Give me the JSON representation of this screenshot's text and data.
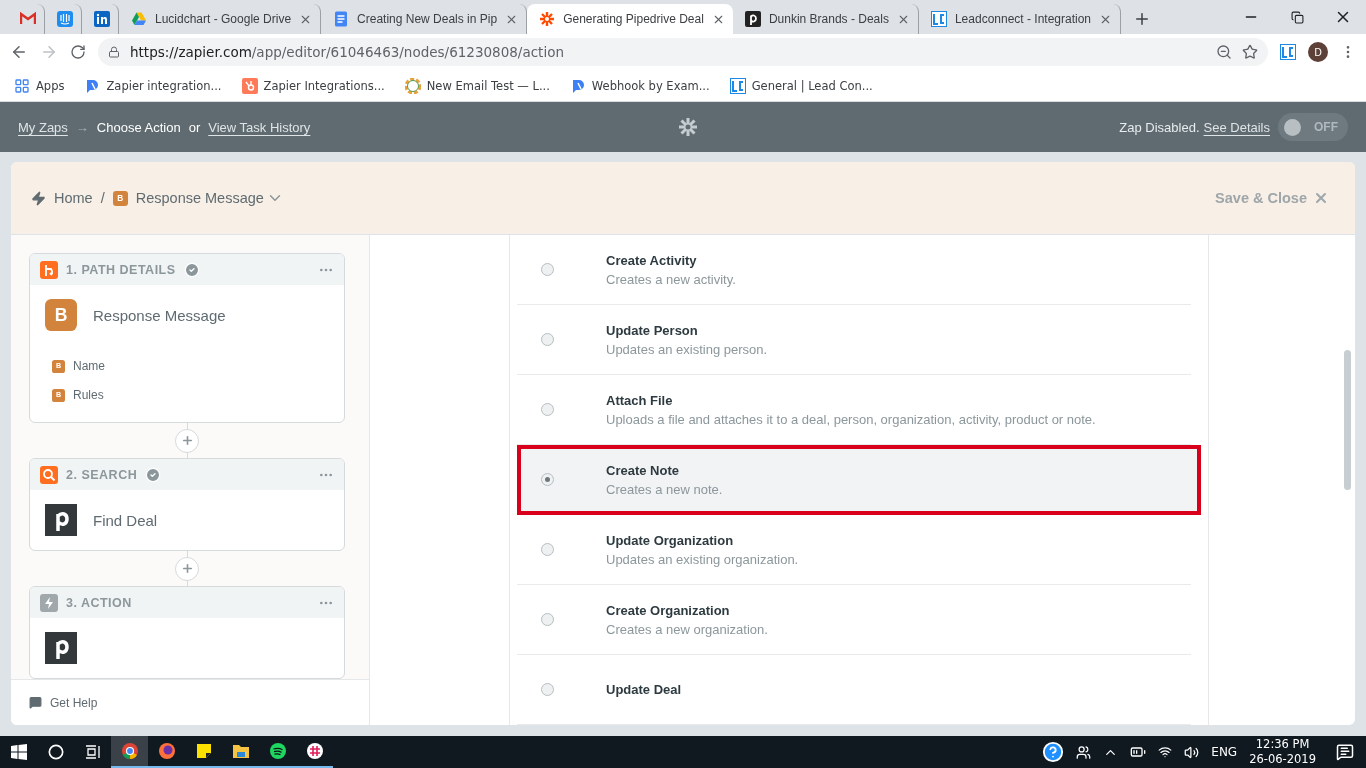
{
  "browser": {
    "tabs": [
      {
        "kind": "gmail",
        "selected": false
      },
      {
        "kind": "intercom",
        "selected": false
      },
      {
        "kind": "linkedin",
        "selected": false
      },
      {
        "kind": "drive",
        "title": "Lucidchart - Google Drive",
        "selected": false
      },
      {
        "kind": "docs",
        "title": "Creating New Deals in Pip",
        "selected": false
      },
      {
        "kind": "zapier",
        "title": "Generating Pipedrive Deal",
        "selected": true
      },
      {
        "kind": "pipedrive",
        "title": "Dunkin Brands - Deals",
        "selected": false
      },
      {
        "kind": "leadconnect",
        "title": "Leadconnect - Integration",
        "selected": false
      }
    ],
    "url_host": "https://zapier.com",
    "url_path": "/app/editor/61046463/nodes/61230808/action",
    "profile_initial": "D",
    "bookmarks": [
      {
        "kind": "apps",
        "label": "Apps"
      },
      {
        "kind": "webhook",
        "label": "Zapier integration..."
      },
      {
        "kind": "hubspot",
        "label": "Zapier Integrations..."
      },
      {
        "kind": "wheel",
        "label": "New Email Test — L..."
      },
      {
        "kind": "webhook",
        "label": "Webhook by Exam..."
      },
      {
        "kind": "leadconnect",
        "label": "General | Lead Con..."
      }
    ]
  },
  "topbar": {
    "my_zaps": "My Zaps",
    "arrow": "→",
    "current": "Choose Action",
    "or": "or",
    "history": "View Task History",
    "status": "Zap Disabled.",
    "details": "See Details",
    "toggle": {
      "on": false,
      "label": "OFF"
    }
  },
  "breadcrumb": {
    "home": "Home",
    "separator": "/",
    "badge": "B",
    "current": "Response Message",
    "save": "Save & Close"
  },
  "steps": [
    {
      "kind": "path",
      "title": "1. PATH DETAILS",
      "checked": true,
      "app": "Response Message",
      "app_letter": "B",
      "fields": [
        {
          "badge": "B",
          "label": "Name"
        },
        {
          "badge": "B",
          "label": "Rules"
        }
      ]
    },
    {
      "kind": "search",
      "title": "2. SEARCH",
      "checked": true,
      "app": "Find Deal"
    },
    {
      "kind": "action",
      "title": "3. ACTION",
      "checked": false
    }
  ],
  "help": "Get Help",
  "actions": [
    {
      "title": "Create Activity",
      "description": "Creates a new activity.",
      "selected": false
    },
    {
      "title": "Update Person",
      "description": "Updates an existing person.",
      "selected": false
    },
    {
      "title": "Attach File",
      "description": "Uploads a file and attaches it to a deal, person, organization, activity, product or note.",
      "selected": false
    },
    {
      "title": "Create Note",
      "description": "Creates a new note.",
      "selected": true
    },
    {
      "title": "Update Organization",
      "description": "Updates an existing organization.",
      "selected": false
    },
    {
      "title": "Create Organization",
      "description": "Creates a new organization.",
      "selected": false
    },
    {
      "title": "Update Deal",
      "selected": false
    }
  ],
  "taskbar": {
    "apps": [
      {
        "kind": "chrome",
        "selected": true
      },
      {
        "kind": "firefox",
        "selected": false
      },
      {
        "kind": "notes",
        "selected": false
      },
      {
        "kind": "explorer",
        "selected": false
      },
      {
        "kind": "spotify",
        "selected": false
      },
      {
        "kind": "slack",
        "selected": false
      }
    ],
    "language": "ENG",
    "time": "12:36 PM",
    "date": "26-06-2019"
  }
}
